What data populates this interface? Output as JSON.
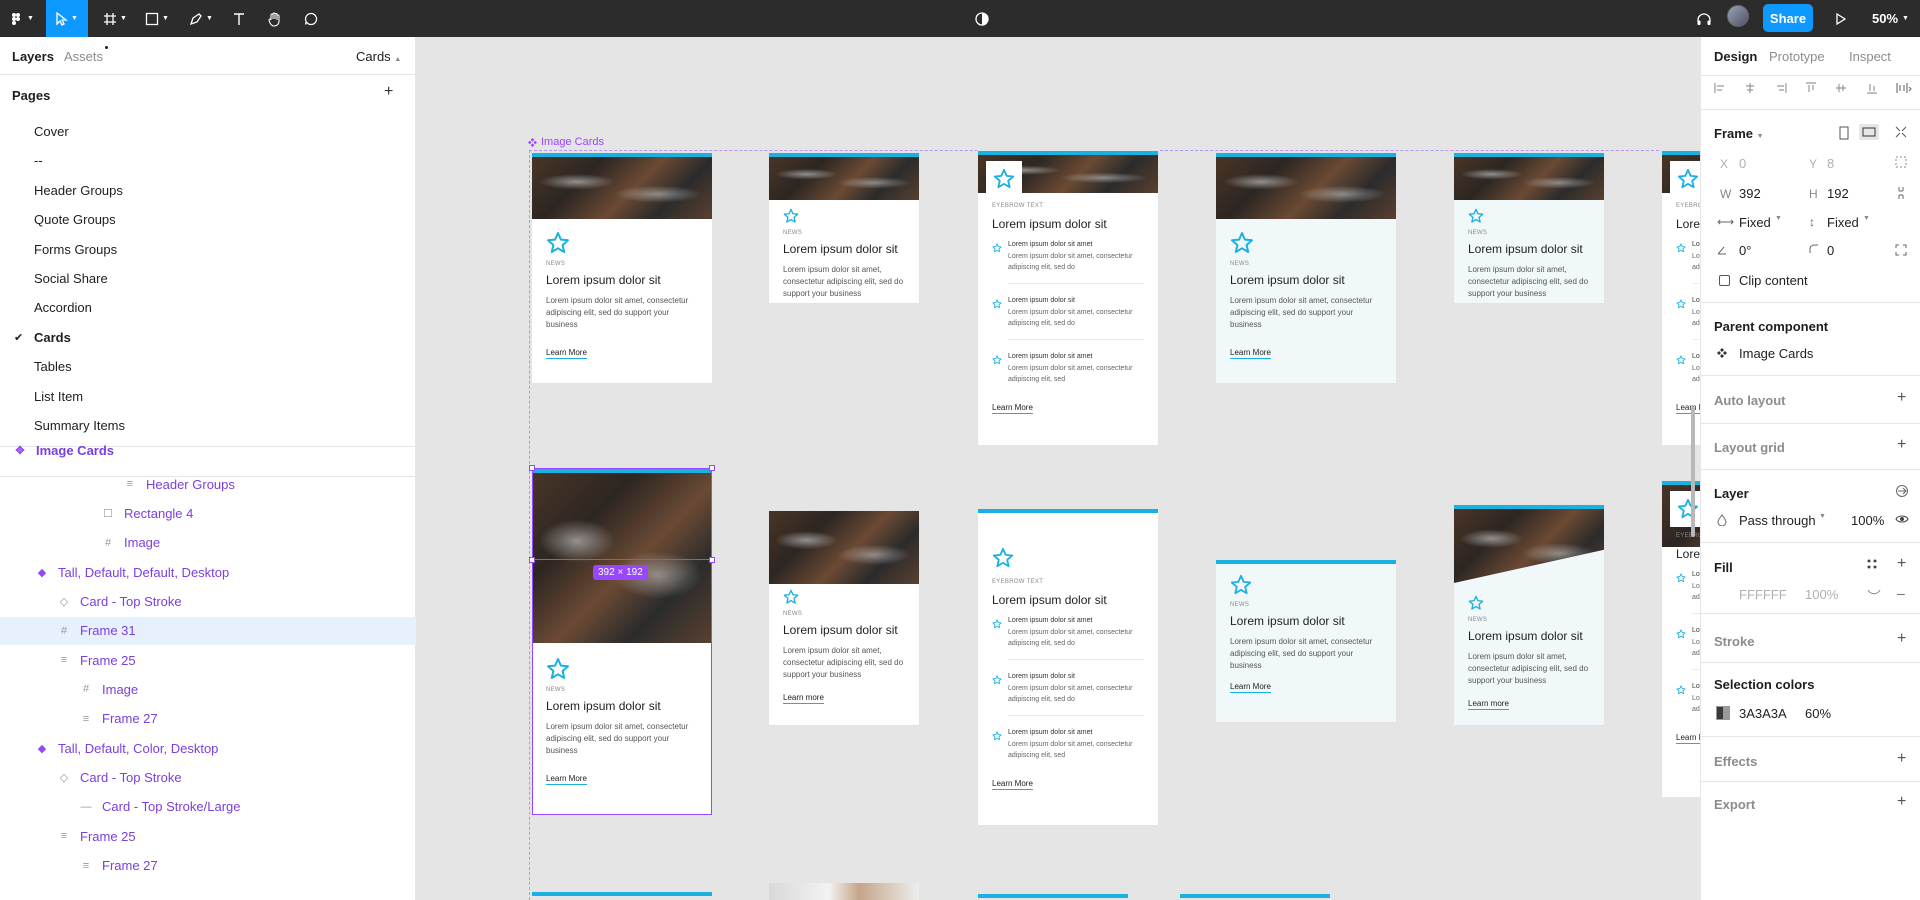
{
  "toolbar": {
    "share_label": "Share",
    "zoom_label": "50%",
    "icons": [
      "figma-menu-icon",
      "move-tool-icon",
      "frame-tool-icon",
      "shape-tool-icon",
      "pen-tool-icon",
      "text-tool-icon",
      "hand-tool-icon",
      "comment-tool-icon",
      "theme-toggle-icon",
      "headphones-icon",
      "play-icon"
    ]
  },
  "left_panel": {
    "tab_layers": "Layers",
    "tab_assets": "Assets",
    "current_page_selector": "Cards",
    "pages_heading": "Pages",
    "pages": [
      "Cover",
      "--",
      "Header Groups",
      "Quote Groups",
      "Forms Groups",
      "Social Share",
      "Accordion",
      "Cards",
      "Tables",
      "List Item",
      "Summary Items"
    ],
    "current_page": "Cards",
    "layers": [
      {
        "label": "Image Cards",
        "indent": 0,
        "type": "component"
      },
      {
        "label": "Header Groups",
        "indent": 5,
        "type": "text"
      },
      {
        "label": "Rectangle 4",
        "indent": 4,
        "type": "rect"
      },
      {
        "label": "Image",
        "indent": 4,
        "type": "frame"
      },
      {
        "label": "Tall, Default, Default, Desktop",
        "indent": 1,
        "type": "variant"
      },
      {
        "label": "Card - Top Stroke",
        "indent": 2,
        "type": "instance"
      },
      {
        "label": "Frame 31",
        "indent": 2,
        "type": "frame",
        "selected": true
      },
      {
        "label": "Frame 25",
        "indent": 2,
        "type": "autolayout"
      },
      {
        "label": "Image",
        "indent": 3,
        "type": "frame"
      },
      {
        "label": "Frame 27",
        "indent": 3,
        "type": "autolayout"
      },
      {
        "label": "Tall, Default, Color, Desktop",
        "indent": 1,
        "type": "variant"
      },
      {
        "label": "Card - Top Stroke",
        "indent": 2,
        "type": "instance"
      },
      {
        "label": "Card - Top Stroke/Large",
        "indent": 3,
        "type": "line"
      },
      {
        "label": "Frame 25",
        "indent": 2,
        "type": "autolayout"
      },
      {
        "label": "Frame 27",
        "indent": 3,
        "type": "autolayout"
      }
    ]
  },
  "canvas": {
    "frame_label": "Image Cards",
    "selection_size": "392 × 192",
    "card_text": {
      "eyebrow_news": "NEWS",
      "eyebrow_text": "EYEBROW TEXT",
      "title": "Lorem ipsum dolor sit",
      "body": "Lorem ipsum dolor sit amet, consectetur adipiscing elit, sed do support your business",
      "body_short": "Lorem ipsum dolor sit amet, consectetur adipiscing elit, sed do support your business",
      "link": "Learn More",
      "link_lower": "Learn more",
      "list_title": "Lorem ipsum dolor sit amet",
      "list_body": "Lorem ipsum dolor sit amet, consectetur adipiscing elit, sed do",
      "list_title2": "Lorem ipsum dolor sit",
      "list_body2": "Lorem ipsum dolor sit amet, consectetur adipiscing elit, sed do",
      "list_body3": "Lorem ipsum dolor sit amet, consectetur adipiscing elit, sed"
    }
  },
  "right_panel": {
    "tab_design": "Design",
    "tab_prototype": "Prototype",
    "tab_inspect": "Inspect",
    "frame_heading": "Frame",
    "x_label": "X",
    "x_value": "0",
    "y_label": "Y",
    "y_value": "8",
    "w_label": "W",
    "w_value": "392",
    "h_label": "H",
    "h_value": "192",
    "width_mode": "Fixed",
    "height_mode": "Fixed",
    "rotation": "0°",
    "radius": "0",
    "clip_content": "Clip content",
    "parent_component_heading": "Parent component",
    "parent_component": "Image Cards",
    "auto_layout": "Auto layout",
    "layout_grid": "Layout grid",
    "layer_heading": "Layer",
    "blend_mode": "Pass through",
    "layer_opacity": "100%",
    "fill_heading": "Fill",
    "fill_hex": "FFFFFF",
    "fill_opacity": "100%",
    "stroke_heading": "Stroke",
    "selection_colors_heading": "Selection colors",
    "selection_color_hex": "3A3A3A",
    "selection_color_opacity": "60%",
    "effects_heading": "Effects",
    "export_heading": "Export"
  },
  "colors": {
    "toolbar_bg": "#2c2c2c",
    "accent_blue": "#0d99ff",
    "component_purple": "#9747ff",
    "card_stroke_cyan": "#1ab0e0"
  }
}
